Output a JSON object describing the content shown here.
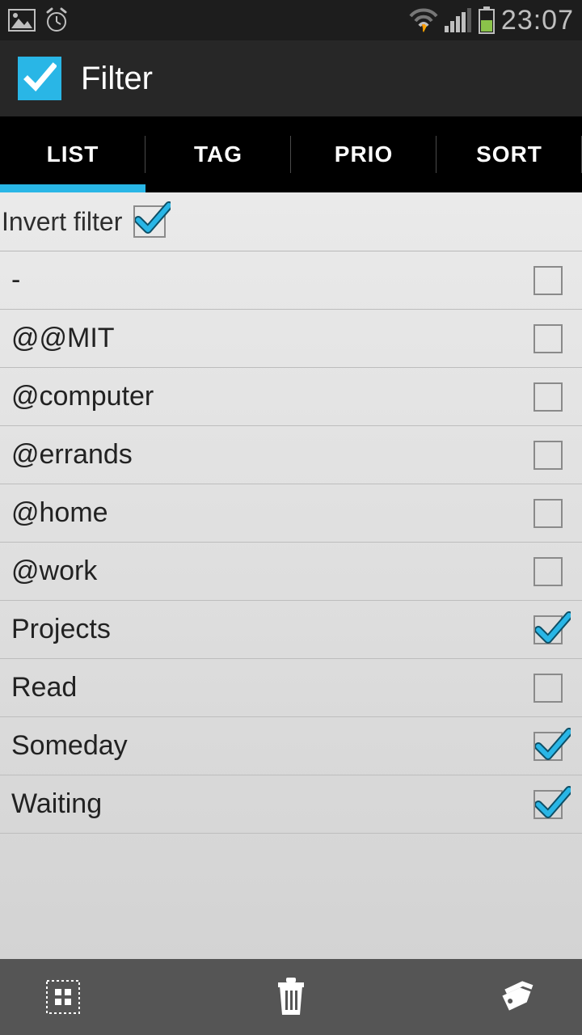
{
  "statusbar": {
    "time": "23:07"
  },
  "appbar": {
    "title": "Filter"
  },
  "tabs": {
    "items": [
      {
        "label": "LIST",
        "active": true
      },
      {
        "label": "TAG",
        "active": false
      },
      {
        "label": "PRIO",
        "active": false
      },
      {
        "label": "SORT",
        "active": false
      }
    ]
  },
  "invert": {
    "label": "Invert filter",
    "checked": true
  },
  "list": [
    {
      "label": "-",
      "checked": false
    },
    {
      "label": "@@MIT",
      "checked": false
    },
    {
      "label": "@computer",
      "checked": false
    },
    {
      "label": "@errands",
      "checked": false
    },
    {
      "label": "@home",
      "checked": false
    },
    {
      "label": "@work",
      "checked": false
    },
    {
      "label": "Projects",
      "checked": true
    },
    {
      "label": "Read",
      "checked": false
    },
    {
      "label": "Someday",
      "checked": true
    },
    {
      "label": "Waiting",
      "checked": true
    }
  ],
  "colors": {
    "accent": "#29b6e6"
  }
}
